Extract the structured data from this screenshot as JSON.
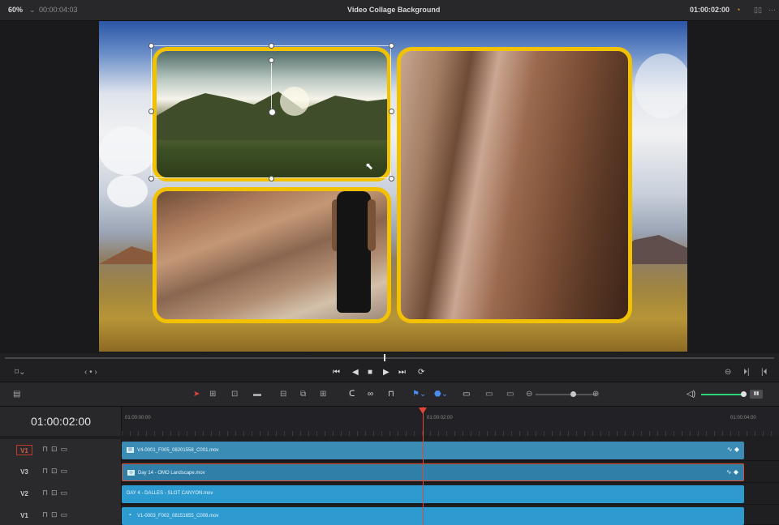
{
  "topbar": {
    "zoom": "60%",
    "source_timecode": "00:00:04:03",
    "title": "Video Collage Background",
    "timecode_right": "01:00:02:00"
  },
  "timeline": {
    "timecode": "01:00:02:00",
    "ruler_labels": [
      "01:00:00:00",
      "01:00:02:00",
      "01:00:04:00"
    ],
    "tracks": [
      {
        "name": "V1",
        "boxed": true,
        "clip": "V4-0001_F005_08201558_C001.mov"
      },
      {
        "name": "V3",
        "boxed": false,
        "clip": "Day 14 - OMO Landscape.mov"
      },
      {
        "name": "V2",
        "boxed": false,
        "clip": "DAY 4 - DALLES - SLOT CANYON.mov"
      },
      {
        "name": "V1",
        "boxed": false,
        "clip": "V1-0003_F002_08151655_C008.mov"
      }
    ]
  },
  "colors": {
    "accent_playhead": "#e0463a",
    "collage_border": "#f2c200",
    "clip_blue": "#3b8cb4",
    "audio_meter": "#2bd47c"
  },
  "icons": {
    "transport": [
      "go-to-start-icon",
      "step-back-icon",
      "stop-icon",
      "play-icon",
      "go-to-end-icon",
      "loop-icon"
    ],
    "toolbar": [
      "selection-tool-icon",
      "trim-tool-icon",
      "dynamic-trim-icon",
      "blade-icon",
      "insert-clip-icon",
      "overwrite-clip-icon",
      "replace-clip-icon",
      "snapping-icon",
      "linked-selection-icon",
      "position-lock-icon",
      "flag-icon",
      "marker-icon",
      "full-extent-zoom-icon",
      "detail-zoom-icon",
      "custom-zoom-icon",
      "volume-icon"
    ]
  }
}
